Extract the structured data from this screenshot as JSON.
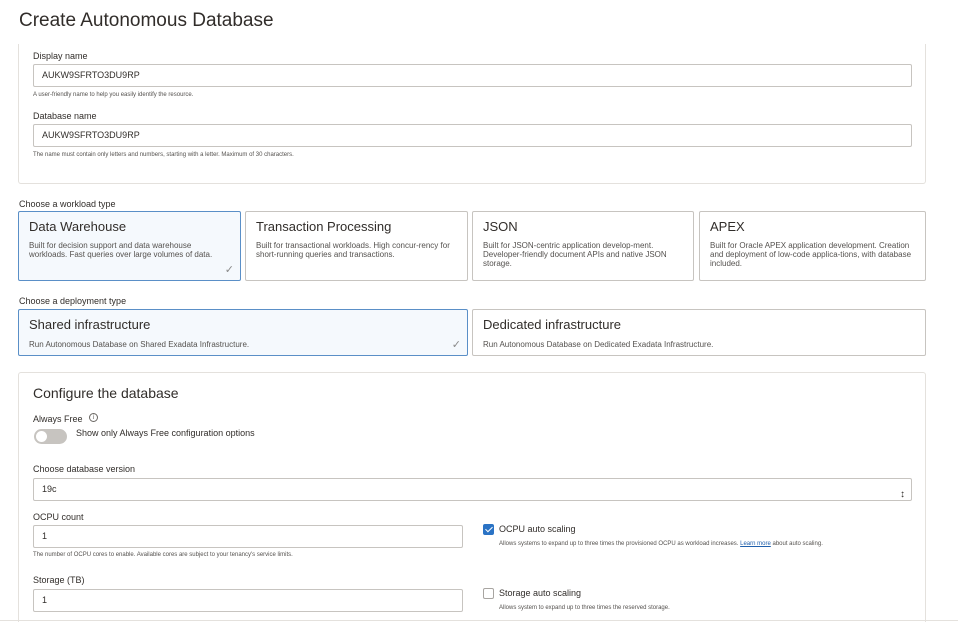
{
  "page": {
    "title": "Create Autonomous Database"
  },
  "basic": {
    "display_name_label": "Display name",
    "display_name_value": "AUKW9SFRTO3DU9RP",
    "display_name_help": "A user-friendly name to help you easily identify the resource.",
    "database_name_label": "Database name",
    "database_name_value": "AUKW9SFRTO3DU9RP",
    "database_name_help": "The name must contain only letters and numbers, starting with a letter. Maximum of 30 characters."
  },
  "workload": {
    "label": "Choose a workload type",
    "cards": [
      {
        "title": "Data Warehouse",
        "desc": "Built for decision support and data warehouse workloads. Fast queries over large volumes of data.",
        "selected": true
      },
      {
        "title": "Transaction Processing",
        "desc": "Built for transactional workloads. High concur-rency for short-running queries and transactions.",
        "selected": false
      },
      {
        "title": "JSON",
        "desc": "Built for JSON-centric application develop-ment. Developer-friendly document APIs and native JSON storage.",
        "selected": false
      },
      {
        "title": "APEX",
        "desc": "Built for Oracle APEX application development. Creation and deployment of low-code applica-tions, with database included.",
        "selected": false
      }
    ]
  },
  "deployment": {
    "label": "Choose a deployment type",
    "cards": [
      {
        "title": "Shared infrastructure",
        "desc": "Run Autonomous Database on Shared Exadata Infrastructure.",
        "selected": true
      },
      {
        "title": "Dedicated infrastructure",
        "desc": "Run Autonomous Database on Dedicated Exadata Infrastructure.",
        "selected": false
      }
    ]
  },
  "configure": {
    "title": "Configure the database",
    "always_free_label": "Always Free",
    "info_glyph": "i",
    "toggle_label": "Show only Always Free configuration options",
    "toggle_on": false,
    "version_label": "Choose database version",
    "version_value": "19c",
    "ocpu_label": "OCPU count",
    "ocpu_value": "1",
    "ocpu_help": "The number of OCPU cores to enable. Available cores are subject to your tenancy's service limits.",
    "ocpu_autoscale_label": "OCPU auto scaling",
    "ocpu_autoscale_checked": true,
    "ocpu_autoscale_help_pre": "Allows systems to expand up to three times the provisioned OCPU as workload increases.",
    "ocpu_autoscale_link": "Learn more",
    "ocpu_autoscale_help_post": "about auto scaling.",
    "storage_label": "Storage (TB)",
    "storage_value": "1",
    "storage_autoscale_label": "Storage auto scaling",
    "storage_autoscale_checked": false,
    "storage_autoscale_help": "Allows system to expand up to three times the reserved storage."
  },
  "icons": {
    "check": "check-icon",
    "chevron": "up-down-chevron-icon",
    "info": "info-icon"
  },
  "colors": {
    "accent": "#2a73c5",
    "selected_border": "#5a8fc7",
    "link": "#1f5fab"
  }
}
